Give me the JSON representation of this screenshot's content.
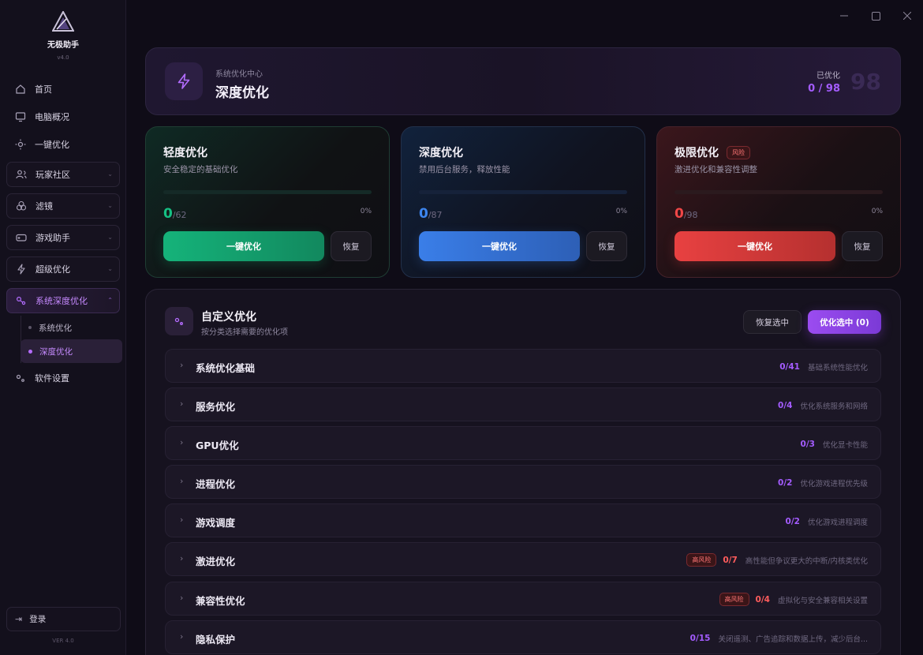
{
  "app": {
    "name": "无极助手",
    "version": "v4.0",
    "footer_version": "VER 4.0"
  },
  "sidebar": {
    "items": [
      {
        "label": "首页",
        "icon": "home-icon"
      },
      {
        "label": "电脑概况",
        "icon": "monitor-icon"
      },
      {
        "label": "一键优化",
        "icon": "sun-icon"
      },
      {
        "label": "玩家社区",
        "icon": "users-icon"
      },
      {
        "label": "滤镜",
        "icon": "filter-icon"
      },
      {
        "label": "游戏助手",
        "icon": "gamepad-icon"
      },
      {
        "label": "超级优化",
        "icon": "bolt-icon"
      },
      {
        "label": "系统深度优化",
        "icon": "nodes-icon"
      },
      {
        "label": "软件设置",
        "icon": "settings-icon"
      }
    ],
    "sub_items": [
      {
        "label": "系统优化"
      },
      {
        "label": "深度优化"
      }
    ],
    "login_label": "登录"
  },
  "header": {
    "subtitle": "系统优化中心",
    "title": "深度优化",
    "optimized_label": "已优化",
    "optimized_count": "0 / 98",
    "total_big": "98"
  },
  "tiers": [
    {
      "title": "轻度优化",
      "badge": "",
      "desc": "安全稳定的基础优化",
      "done": "0",
      "total": "/62",
      "percent": "0%",
      "progress": 0,
      "action": "一键优化",
      "restore": "恢复"
    },
    {
      "title": "深度优化",
      "badge": "",
      "desc": "禁用后台服务，释放性能",
      "done": "0",
      "total": "/87",
      "percent": "0%",
      "progress": 0,
      "action": "一键优化",
      "restore": "恢复"
    },
    {
      "title": "极限优化",
      "badge": "风险",
      "desc": "激进优化和兼容性调整",
      "done": "0",
      "total": "/98",
      "percent": "0%",
      "progress": 0,
      "action": "一键优化",
      "restore": "恢复"
    }
  ],
  "custom": {
    "title": "自定义优化",
    "subtitle": "按分类选择需要的优化项",
    "restore_selected": "恢复选中",
    "optimize_selected": "优化选中 (0)",
    "categories": [
      {
        "name": "系统优化基础",
        "count": "0/41",
        "desc": "基础系统性能优化",
        "badge": ""
      },
      {
        "name": "服务优化",
        "count": "0/4",
        "desc": "优化系统服务和网络",
        "badge": ""
      },
      {
        "name": "GPU优化",
        "count": "0/3",
        "desc": "优化显卡性能",
        "badge": ""
      },
      {
        "name": "进程优化",
        "count": "0/2",
        "desc": "优化游戏进程优先级",
        "badge": ""
      },
      {
        "name": "游戏调度",
        "count": "0/2",
        "desc": "优化游戏进程调度",
        "badge": ""
      },
      {
        "name": "激进优化",
        "count": "0/7",
        "desc": "高性能但争议更大的中断/内核类优化",
        "badge": "高风险"
      },
      {
        "name": "兼容性优化",
        "count": "0/4",
        "desc": "虚拟化与安全兼容相关设置",
        "badge": "高风险"
      },
      {
        "name": "隐私保护",
        "count": "0/15",
        "desc": "关闭遥测、广告追踪和数据上传，减少后台...",
        "badge": ""
      }
    ]
  },
  "colors": {
    "accent": "#a45cff",
    "green": "#15b37a",
    "blue": "#3a7ee8",
    "red": "#e84141"
  }
}
